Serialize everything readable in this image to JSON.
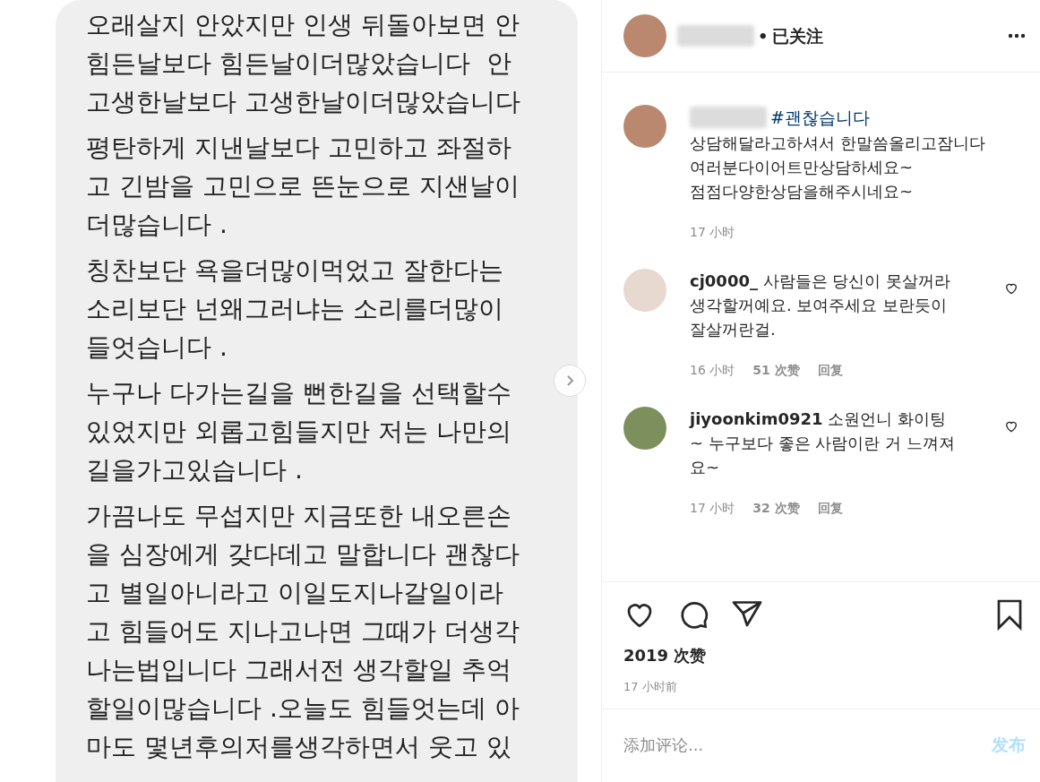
{
  "post_image": {
    "paragraphs": [
      [
        "오래살지 안았지만 인생 뒤돌아보면 안",
        "힘든날보다 힘든날이더많았습니다  안",
        "고생한날보다 고생한날이더많았습니다"
      ],
      [
        "평탄하게 지낸날보다 고민하고 좌절하",
        "고 긴밤을 고민으로 뜬눈으로 지샌날이",
        "더많습니다 ."
      ],
      [
        "칭찬보단 욕을더많이먹었고 잘한다는",
        "소리보단 넌왜그러냐는 소리를더많이",
        "들엇습니다 ."
      ],
      [
        "누구나 다가는길을 뻔한길을 선택할수",
        "있었지만 외롭고힘들지만 저는 나만의",
        "길을가고있습니다 ."
      ],
      [
        "가끔나도 무섭지만 지금또한 내오른손",
        "을 심장에게 갖다데고 말합니다 괜찮다",
        "고 별일아니라고 이일도지나갈일이라",
        "고 힘들어도 지나고나면 그때가 더생각",
        "나는법입니다 그래서전 생각할일 추억",
        "할일이많습니다 .오늘도 힘들엇는데 아",
        "마도 몇년후의저를생각하면서 웃고 있"
      ]
    ]
  },
  "header": {
    "separator": "•",
    "follow_status": "已关注"
  },
  "caption": {
    "hashtag": "#괜찮습니다",
    "lines": [
      "상담해달라고하셔서 한말씀올리고잠니다",
      "여러분다이어트만상담하세요~",
      "점점다양한상담을해주시네요~"
    ],
    "time": "17 小时"
  },
  "comments": [
    {
      "username": "cj0000_",
      "text": "사람들은 당신이 못살꺼라생각할꺼예요. 보여주세요 보란듯이 잘살꺼란걸.",
      "time": "16 小时",
      "likes": "51 次赞",
      "reply": "回复",
      "liked": false
    },
    {
      "username": "jiyoonkim0921",
      "text": "소원언니 화이팅~ 누구보다 좋은 사람이란 거 느껴져요~",
      "time": "17 小时",
      "likes": "32 次赞",
      "reply": "回复",
      "liked": false
    }
  ],
  "actions": {
    "liked": false,
    "saved": false
  },
  "likes": "2019 次赞",
  "post_time": "17 小时前",
  "comment_field": {
    "placeholder": "添加评论..."
  },
  "post_button": {
    "label": "发布",
    "disabled": true
  }
}
